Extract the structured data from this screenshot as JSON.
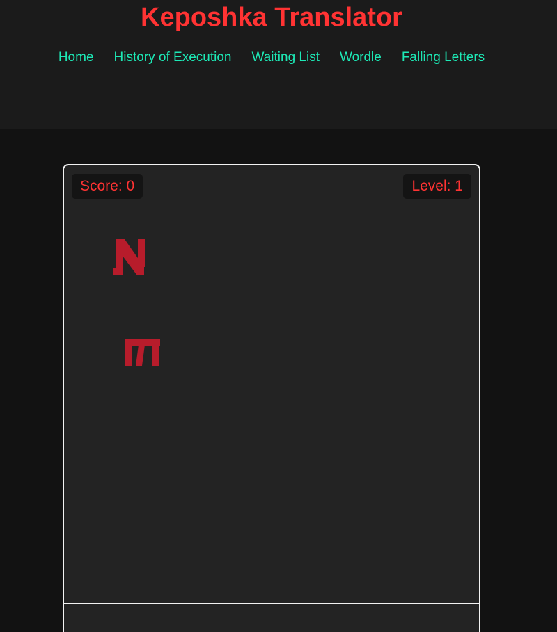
{
  "site": {
    "title": "Keposhka Translator"
  },
  "nav": {
    "items": [
      {
        "label": "Home",
        "key": "home"
      },
      {
        "label": "History of Execution",
        "key": "history"
      },
      {
        "label": "Waiting List",
        "key": "waiting-list"
      },
      {
        "label": "Wordle",
        "key": "wordle"
      },
      {
        "label": "Falling Letters",
        "key": "falling-letters"
      }
    ]
  },
  "game": {
    "score_label": "Score: 0",
    "level_label": "Level: 1",
    "falling_letters": [
      {
        "glyph": "keposhka-n-glyph"
      },
      {
        "glyph": "keposhka-m-glyph"
      }
    ]
  },
  "colors": {
    "accent_red": "#ff3333",
    "nav_teal": "#1de9b6",
    "letter_red": "#b71c2b",
    "header_bg": "#1b1b1b",
    "page_bg": "#121212",
    "board_bg": "#232323"
  }
}
